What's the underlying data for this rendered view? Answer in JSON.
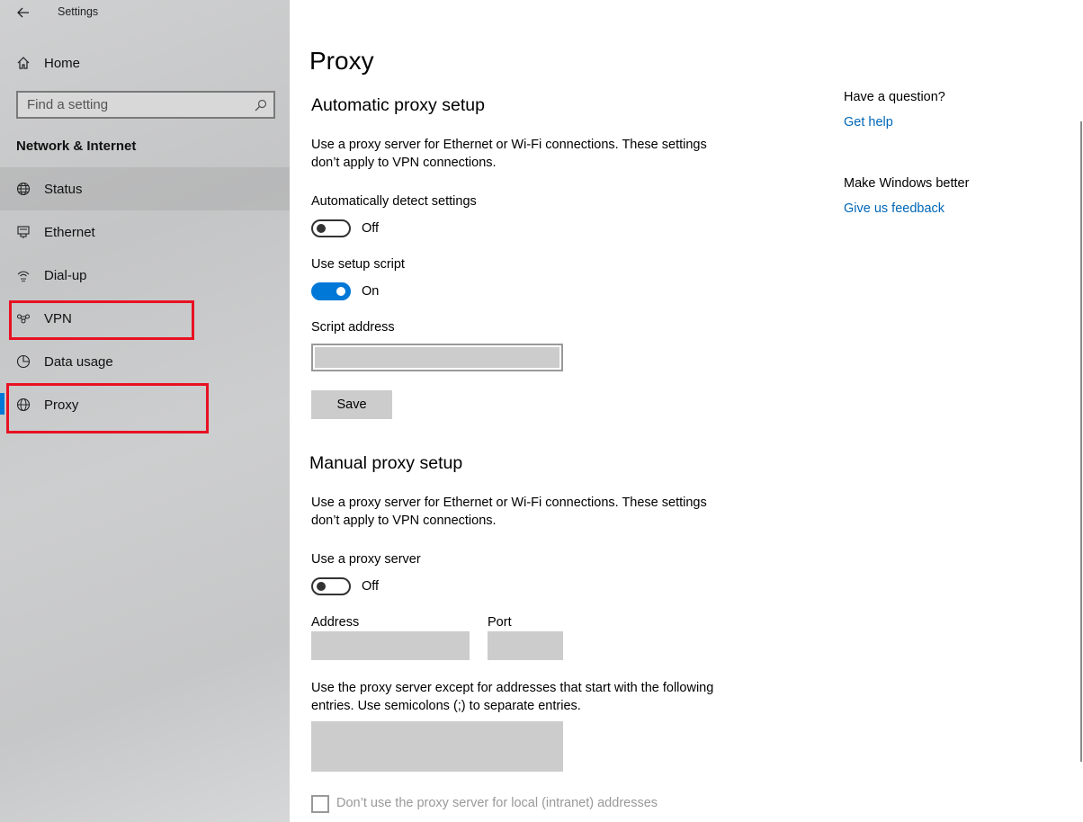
{
  "app": {
    "title": "Settings"
  },
  "sidebar": {
    "home_label": "Home",
    "search_placeholder": "Find a setting",
    "section_title": "Network & Internet",
    "items": [
      {
        "label": "Status",
        "icon": "globe-status-icon"
      },
      {
        "label": "Ethernet",
        "icon": "ethernet-icon"
      },
      {
        "label": "Dial-up",
        "icon": "dial-up-icon"
      },
      {
        "label": "VPN",
        "icon": "vpn-icon"
      },
      {
        "label": "Data usage",
        "icon": "data-usage-icon"
      },
      {
        "label": "Proxy",
        "icon": "globe-icon"
      }
    ],
    "selected": "Proxy"
  },
  "main": {
    "page_title": "Proxy",
    "auto": {
      "heading": "Automatic proxy setup",
      "description": "Use a proxy server for Ethernet or Wi-Fi connections. These settings don’t apply to VPN connections.",
      "detect_label": "Automatically detect settings",
      "detect_state": "Off",
      "script_label": "Use setup script",
      "script_state": "On",
      "address_label": "Script address",
      "address_value": "",
      "save_label": "Save"
    },
    "manual": {
      "heading": "Manual proxy setup",
      "description": "Use a proxy server for Ethernet or Wi-Fi connections. These settings don’t apply to VPN connections.",
      "use_proxy_label": "Use a proxy server",
      "use_proxy_state": "Off",
      "address_label": "Address",
      "address_value": "",
      "port_label": "Port",
      "port_value": "",
      "exceptions_description": "Use the proxy server except for addresses that start with the following entries. Use semicolons (;) to separate entries.",
      "exceptions_value": "",
      "local_checkbox_label": "Don’t use the proxy server for local (intranet) addresses"
    },
    "side": {
      "question_heading": "Have a question?",
      "help_link": "Get help",
      "better_heading": "Make Windows better",
      "feedback_link": "Give us feedback"
    }
  },
  "colors": {
    "accent": "#0078d7",
    "link": "#0067b8",
    "annotation": "#e81123"
  }
}
